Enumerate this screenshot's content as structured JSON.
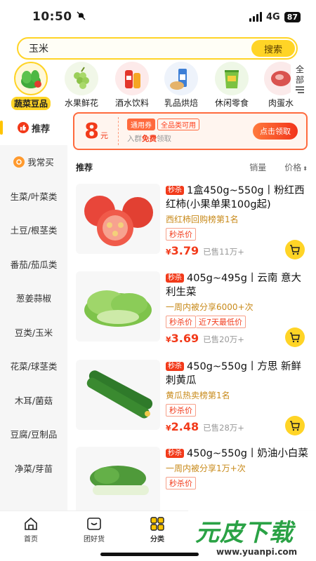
{
  "status": {
    "time": "10:50",
    "network": "4G",
    "battery": "87"
  },
  "search": {
    "query": "玉米",
    "button": "搜索"
  },
  "categories": [
    {
      "label": "蔬菜豆品",
      "icon": "vegetable-icon"
    },
    {
      "label": "水果鲜花",
      "icon": "grapes-icon"
    },
    {
      "label": "酒水饮料",
      "icon": "drinks-icon"
    },
    {
      "label": "乳品烘焙",
      "icon": "dairy-bread-icon"
    },
    {
      "label": "休闲零食",
      "icon": "snacks-icon"
    },
    {
      "label": "肉蛋水",
      "icon": "meat-icon"
    }
  ],
  "all_categories": {
    "line1": "全",
    "line2": "部"
  },
  "sidebar": [
    {
      "label": "推荐"
    },
    {
      "label": "我常买"
    },
    {
      "label": "生菜/叶菜类"
    },
    {
      "label": "土豆/根茎类"
    },
    {
      "label": "番茄/茄瓜类"
    },
    {
      "label": "葱姜蒜椒"
    },
    {
      "label": "豆类/玉米"
    },
    {
      "label": "花菜/球茎类"
    },
    {
      "label": "木耳/菌菇"
    },
    {
      "label": "豆腐/豆制品"
    },
    {
      "label": "净菜/芽苗"
    }
  ],
  "coupon": {
    "amount": "8",
    "unit": "元",
    "tag1": "通用券",
    "tag2": "全品类可用",
    "desc_prefix": "入群",
    "desc_free": "免费",
    "desc_suffix": "领取",
    "claim": "点击领取"
  },
  "sort": {
    "recommend": "推荐",
    "sales": "销量",
    "price": "价格"
  },
  "products": [
    {
      "flash": "秒杀",
      "title": "1盒450g~550g丨粉红西红柿(小果单果100g起)",
      "sub": "西红柿回购榜第1名",
      "tags": [
        "秒杀价"
      ],
      "currency": "¥",
      "price": "3.79",
      "sold": "已售11万+"
    },
    {
      "flash": "秒杀",
      "title": "405g~495g丨云南 意大利生菜",
      "sub": "一周内被分享6000+次",
      "tags": [
        "秒杀价",
        "近7天最低价"
      ],
      "currency": "¥",
      "price": "3.69",
      "sold": "已售20万+"
    },
    {
      "flash": "秒杀",
      "title": "450g~550g丨方思 新鲜刺黄瓜",
      "sub": "黄瓜热卖榜第1名",
      "tags": [
        "秒杀价"
      ],
      "currency": "¥",
      "price": "2.48",
      "sold": "已售28万+"
    },
    {
      "flash": "秒杀",
      "title": "450g~550g丨奶油小白菜",
      "sub": "一周内被分享1万+次",
      "tags": [
        "秒杀价"
      ],
      "currency": "¥",
      "price": "",
      "sold": ""
    }
  ],
  "tabs": [
    {
      "label": "首页"
    },
    {
      "label": "团好货"
    },
    {
      "label": "分类"
    }
  ],
  "watermark": {
    "big": "元皮下载",
    "small": "www.yuanpi.com"
  }
}
